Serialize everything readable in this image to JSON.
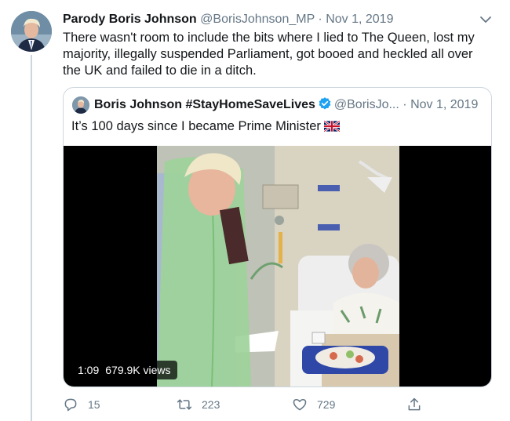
{
  "tweet": {
    "display_name": "Parody Boris Johnson",
    "handle": "@BorisJohnson_MP",
    "separator": "·",
    "date": "Nov 1, 2019",
    "text": "There wasn't room to include the bits where I lied to The Queen, lost my majority, illegally suspended Parliament, got booed and heckled all over the UK and failed to die in a ditch."
  },
  "quoted": {
    "display_name": "Boris Johnson #StayHomeSaveLives",
    "handle": "@BorisJo...",
    "separator": "·",
    "date": "Nov 1, 2019",
    "text": "It’s 100 days since I became Prime Minister",
    "flag_icon": "uk-flag-icon",
    "verified_icon": "verified-badge-icon",
    "video": {
      "duration": "1:09",
      "views": "679.9K views"
    }
  },
  "actions": {
    "replies": "15",
    "retweets": "223",
    "likes": "729"
  },
  "colors": {
    "secondary_text": "#657786",
    "border": "#ccd6dd",
    "verified": "#1da1f2"
  }
}
